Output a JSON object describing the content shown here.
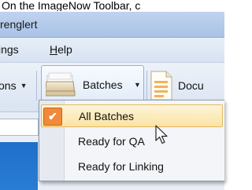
{
  "caption": "On the ImageNow Toolbar, c",
  "window": {
    "title": "renglert"
  },
  "menubar": {
    "items": [
      {
        "label": "ings"
      },
      {
        "label": "Help"
      }
    ]
  },
  "toolbar": {
    "options_label": "ons",
    "batches_label": "Batches",
    "documents_label": "Docu",
    "dropdown_arrow": "▼"
  },
  "batches_menu": {
    "items": [
      {
        "label": "All Batches",
        "checked": true,
        "check_glyph": "✔"
      },
      {
        "label": "Ready for QA"
      },
      {
        "label": "Ready for Linking"
      }
    ]
  },
  "colors": {
    "highlight": "#fbe3a4",
    "check": "#f08a3a",
    "toolbar": "#dce6f4",
    "list": "#1e6fc9"
  }
}
